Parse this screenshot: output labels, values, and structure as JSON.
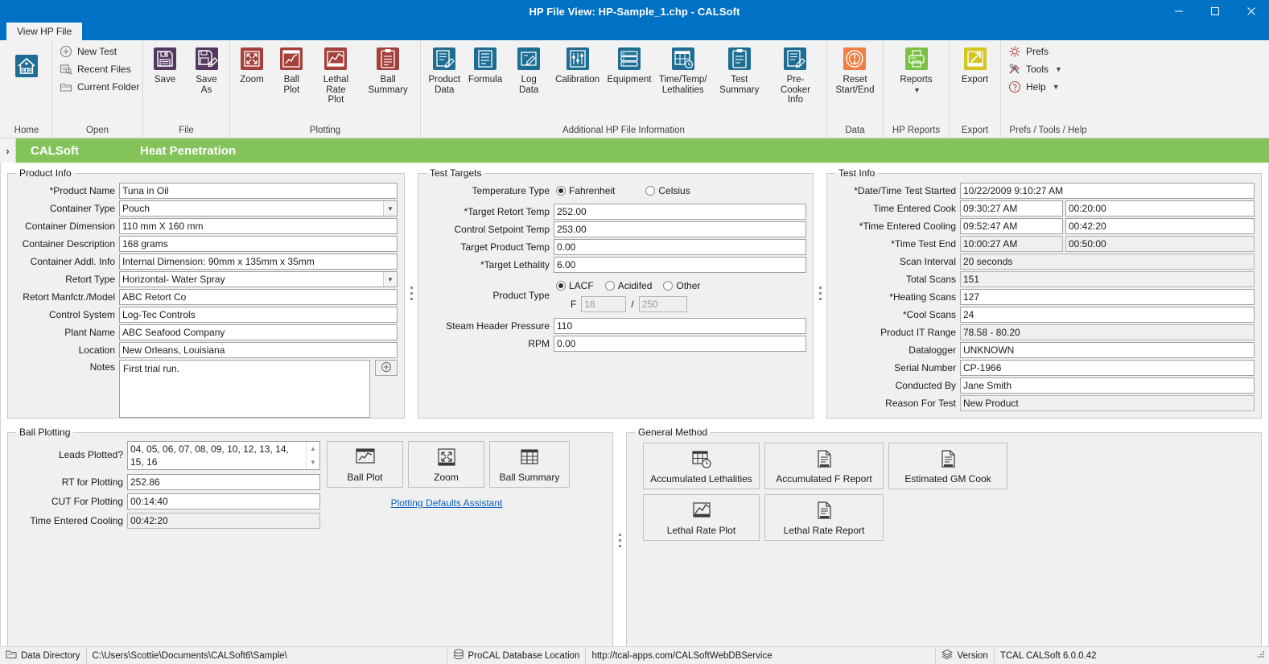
{
  "window": {
    "title": "HP File View: HP-Sample_1.chp - CALSoft",
    "accent": "#0072c6",
    "minimize": "minimize-icon",
    "maximize": "maximize-icon",
    "close": "close-icon",
    "collapse_ribbon": "chevron-up-icon"
  },
  "ribbon": {
    "tab": "View HP File",
    "groups": [
      {
        "label": "Home",
        "items": [
          {
            "label": "",
            "icon": "home-icon",
            "kind": "big"
          }
        ]
      },
      {
        "label": "Open",
        "items": [
          {
            "label": "New Test",
            "icon": "plus-circle-icon",
            "kind": "small"
          },
          {
            "label": "Recent Files",
            "icon": "recent-files-icon",
            "kind": "small"
          },
          {
            "label": "Current Folder",
            "icon": "folder-icon",
            "kind": "small"
          }
        ]
      },
      {
        "label": "File",
        "items": [
          {
            "label": "Save",
            "icon": "save-icon",
            "kind": "big"
          },
          {
            "label": "Save As",
            "icon": "save-as-icon",
            "kind": "big"
          }
        ]
      },
      {
        "label": "Plotting",
        "items": [
          {
            "label": "Zoom",
            "icon": "zoom-icon",
            "kind": "big"
          },
          {
            "label": "Ball Plot",
            "icon": "ball-plot-icon",
            "kind": "big"
          },
          {
            "label": "Lethal\nRate Plot",
            "icon": "lethal-rate-plot-icon",
            "kind": "big"
          },
          {
            "label": "Ball Summary",
            "icon": "ball-summary-icon",
            "kind": "big"
          }
        ]
      },
      {
        "label": "Additional HP File Information",
        "items": [
          {
            "label": "Product\nData",
            "icon": "product-data-icon",
            "kind": "big"
          },
          {
            "label": "Formula",
            "icon": "formula-icon",
            "kind": "big"
          },
          {
            "label": "Log Data",
            "icon": "log-data-icon",
            "kind": "big"
          },
          {
            "label": "Calibration",
            "icon": "calibration-icon",
            "kind": "big"
          },
          {
            "label": "Equipment",
            "icon": "equipment-icon",
            "kind": "big"
          },
          {
            "label": "Time/Temp/\nLethalities",
            "icon": "time-temp-lethalities-icon",
            "kind": "big"
          },
          {
            "label": "Test Summary",
            "icon": "test-summary-icon",
            "kind": "big"
          },
          {
            "label": "Pre-Cooker\nInfo",
            "icon": "pre-cooker-info-icon",
            "kind": "big"
          }
        ]
      },
      {
        "label": "Data",
        "items": [
          {
            "label": "Reset\nStart/End",
            "icon": "reset-start-end-icon",
            "kind": "big"
          }
        ]
      },
      {
        "label": "HP Reports",
        "items": [
          {
            "label": "Reports",
            "icon": "reports-icon",
            "kind": "big",
            "dropdown": true
          }
        ]
      },
      {
        "label": "Export",
        "items": [
          {
            "label": "Export",
            "icon": "export-icon",
            "kind": "big"
          }
        ]
      },
      {
        "label": "Prefs / Tools / Help",
        "items": [
          {
            "label": "Prefs",
            "icon": "gear-icon",
            "kind": "small"
          },
          {
            "label": "Tools",
            "icon": "tools-icon",
            "kind": "small",
            "dropdown": true
          },
          {
            "label": "Help",
            "icon": "help-icon",
            "kind": "small",
            "dropdown": true
          }
        ]
      }
    ]
  },
  "banner": {
    "brand": "CALSoft",
    "section": "Heat Penetration",
    "color": "#83c35a",
    "expander": "chevron-right-icon"
  },
  "product_info": {
    "legend": "Product Info",
    "fields": [
      {
        "label": "*Product Name",
        "value": "Tuna in Oil",
        "type": "text"
      },
      {
        "label": "Container Type",
        "value": "Pouch",
        "type": "combo"
      },
      {
        "label": "Container Dimension",
        "value": "110 mm X 160 mm",
        "type": "text"
      },
      {
        "label": "Container Description",
        "value": "168 grams",
        "type": "text"
      },
      {
        "label": "Container Addl. Info",
        "value": "Internal Dimension: 90mm x 135mm x 35mm",
        "type": "text"
      },
      {
        "label": "Retort Type",
        "value": "Horizontal- Water Spray",
        "type": "combo"
      },
      {
        "label": "Retort Manfctr./Model",
        "value": "ABC Retort Co",
        "type": "text"
      },
      {
        "label": "Control System",
        "value": "Log-Tec Controls",
        "type": "text"
      },
      {
        "label": "Plant Name",
        "value": "ABC Seafood Company",
        "type": "text"
      },
      {
        "label": "Location",
        "value": "New Orleans, Louisiana",
        "type": "text"
      }
    ],
    "notes_label": "Notes",
    "notes_value": "First trial run.",
    "notes_add_icon": "add-note-icon"
  },
  "test_targets": {
    "legend": "Test Targets",
    "temperature_type_label": "Temperature Type",
    "temperature_options": [
      {
        "label": "Fahrenheit",
        "selected": true
      },
      {
        "label": "Celsius",
        "selected": false
      }
    ],
    "fields": [
      {
        "label": "*Target Retort Temp",
        "value": "252.00"
      },
      {
        "label": "Control Setpoint Temp",
        "value": "253.00"
      },
      {
        "label": "Target Product Temp",
        "value": "0.00"
      },
      {
        "label": "*Target Lethality",
        "value": "6.00"
      }
    ],
    "product_type_label": "Product Type",
    "product_type_options": [
      {
        "label": "LACF",
        "selected": true
      },
      {
        "label": "Acidifed",
        "selected": false
      },
      {
        "label": "Other",
        "selected": false
      }
    ],
    "f_label": "F",
    "f_value_placeholder": "18",
    "f_slash": "/",
    "f_temp_placeholder": "250",
    "steam_label": "Steam Header Pressure",
    "steam_value": "110",
    "rpm_label": "RPM",
    "rpm_value": "0.00"
  },
  "test_info": {
    "legend": "Test Info",
    "fields": [
      {
        "label": "*Date/Time Test Started",
        "value": "10/22/2009 9:10:27 AM",
        "value2": null,
        "readonly": false
      },
      {
        "label": "Time Entered Cook",
        "value": "09:30:27 AM",
        "value2": "00:20:00",
        "readonly": false
      },
      {
        "label": "*Time Entered Cooling",
        "value": "09:52:47 AM",
        "value2": "00:42:20",
        "readonly": false
      },
      {
        "label": "*Time Test End",
        "value": "10:00:27 AM",
        "value2": "00:50:00",
        "readonly": true
      },
      {
        "label": "Scan Interval",
        "value": "20 seconds",
        "value2": null,
        "readonly": true
      },
      {
        "label": "Total Scans",
        "value": "151",
        "value2": null,
        "readonly": true
      },
      {
        "label": "*Heating Scans",
        "value": "127",
        "value2": null,
        "readonly": false
      },
      {
        "label": "*Cool Scans",
        "value": "24",
        "value2": null,
        "readonly": false
      },
      {
        "label": "Product IT Range",
        "value": "78.58 - 80.20",
        "value2": null,
        "readonly": true
      },
      {
        "label": "Datalogger",
        "value": "UNKNOWN",
        "value2": null,
        "readonly": false
      },
      {
        "label": "Serial Number",
        "value": "CP-1966",
        "value2": null,
        "readonly": false
      },
      {
        "label": "Conducted By",
        "value": "Jane Smith",
        "value2": null,
        "readonly": false
      },
      {
        "label": "Reason For Test",
        "value": "New Product",
        "value2": null,
        "readonly": true
      }
    ]
  },
  "ball_plotting": {
    "legend": "Ball Plotting",
    "leads_label": "Leads Plotted?",
    "leads_value": "04, 05, 06, 07, 08, 09, 10, 12, 13, 14, 15, 16",
    "fields": [
      {
        "label": "RT for Plotting",
        "value": "252.86",
        "readonly": false
      },
      {
        "label": "CUT For Plotting",
        "value": "00:14:40",
        "readonly": false
      },
      {
        "label": "Time Entered Cooling",
        "value": "00:42:20",
        "readonly": true
      }
    ],
    "buttons": [
      {
        "label": "Ball Plot",
        "icon": "ball-plot-icon"
      },
      {
        "label": "Zoom",
        "icon": "zoom-icon"
      },
      {
        "label": "Ball Summary",
        "icon": "ball-summary-icon"
      }
    ],
    "assistant_link": "Plotting Defaults Assistant"
  },
  "general_method": {
    "legend": "General Method",
    "buttons": [
      {
        "label": "Accumulated Lethalities",
        "icon": "accumulated-lethalities-icon"
      },
      {
        "label": "Accumulated F Report",
        "icon": "report-icon"
      },
      {
        "label": "Estimated GM Cook",
        "icon": "report-icon"
      },
      {
        "label": "Lethal Rate Plot",
        "icon": "lethal-rate-plot-icon"
      },
      {
        "label": "Lethal Rate Report",
        "icon": "report-icon"
      }
    ]
  },
  "statusbar": {
    "data_directory_label": "Data Directory",
    "data_directory_value": "C:\\Users\\Scottie\\Documents\\CALSoft6\\Sample\\",
    "database_label": "ProCAL Database Location",
    "database_value": "http://tcal-apps.com/CALSoftWebDBService",
    "version_label": "Version",
    "version_value": "TCAL CALSoft 6.0.0.42",
    "data_directory_icon": "folder-db-icon",
    "database_icon": "database-icon",
    "version_icon": "stack-icon"
  }
}
